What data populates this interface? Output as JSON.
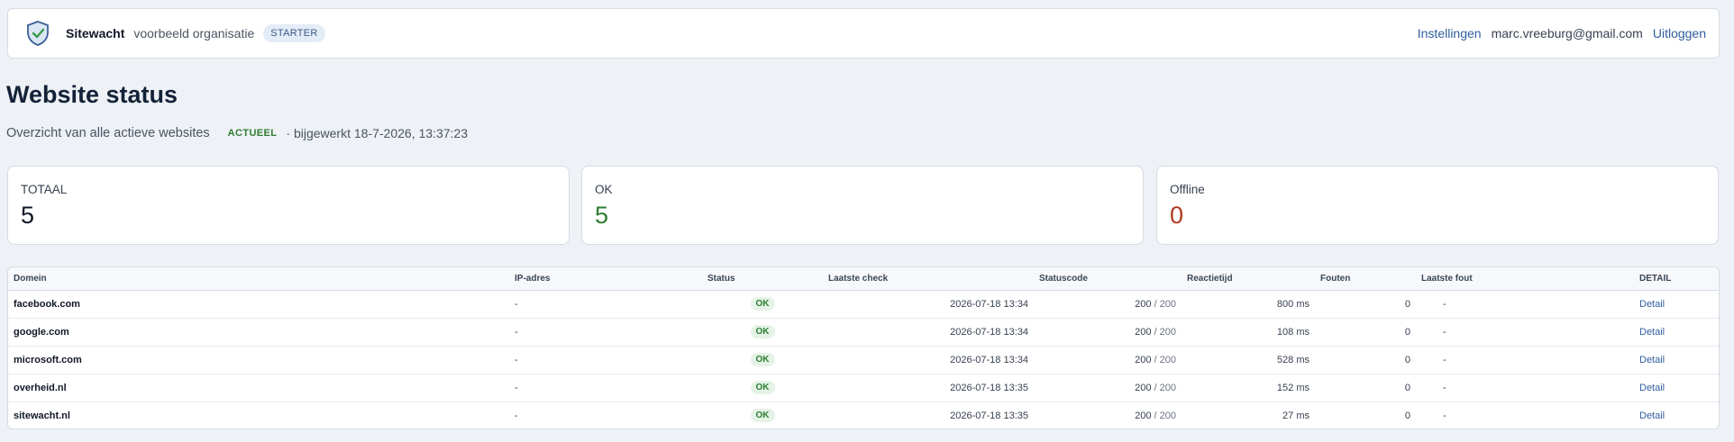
{
  "header": {
    "brand": "Sitewacht",
    "organization": "voorbeeld organisatie",
    "plan": "STARTER",
    "nav": {
      "settings": "Instellingen",
      "email": "marc.vreeburg@gmail.com",
      "logout": "Uitloggen"
    }
  },
  "page": {
    "title": "Website status",
    "subtitle": "Overzicht van alle actieve websites",
    "freshness": "ACTUEEL",
    "updated": "· bijgewerkt 18-7-2026, 13:37:23"
  },
  "stats": {
    "total": {
      "label": "TOTAAL",
      "value": "5"
    },
    "ok": {
      "label": "OK",
      "value": "5"
    },
    "offline": {
      "label": "Offline",
      "value": "0"
    }
  },
  "table": {
    "columns": [
      "Domein",
      "IP-adres",
      "Status",
      "Laatste check",
      "Statuscode",
      "Reactietijd",
      "Fouten",
      "Laatste fout",
      "DETAIL"
    ],
    "rows": [
      {
        "domain": "facebook.com",
        "ip": "-",
        "status": "OK",
        "last_check": "2026-07-18 13:34",
        "code": "200",
        "expected": "/ 200",
        "response": "800 ms",
        "errors": "0",
        "last_error": "-",
        "detail": "Detail"
      },
      {
        "domain": "google.com",
        "ip": "-",
        "status": "OK",
        "last_check": "2026-07-18 13:34",
        "code": "200",
        "expected": "/ 200",
        "response": "108 ms",
        "errors": "0",
        "last_error": "-",
        "detail": "Detail"
      },
      {
        "domain": "microsoft.com",
        "ip": "-",
        "status": "OK",
        "last_check": "2026-07-18 13:34",
        "code": "200",
        "expected": "/ 200",
        "response": "528 ms",
        "errors": "0",
        "last_error": "-",
        "detail": "Detail"
      },
      {
        "domain": "overheid.nl",
        "ip": "-",
        "status": "OK",
        "last_check": "2026-07-18 13:35",
        "code": "200",
        "expected": "/ 200",
        "response": "152 ms",
        "errors": "0",
        "last_error": "-",
        "detail": "Detail"
      },
      {
        "domain": "sitewacht.nl",
        "ip": "-",
        "status": "OK",
        "last_check": "2026-07-18 13:35",
        "code": "200",
        "expected": "/ 200",
        "response": "27 ms",
        "errors": "0",
        "last_error": "-",
        "detail": "Detail"
      }
    ]
  },
  "colors": {
    "accent": "#2f5e9e",
    "ok": "#2e7d32",
    "offline": "#b03a1f",
    "background": "#eef1f5"
  },
  "icons": {
    "logo": "shield-check-icon"
  }
}
